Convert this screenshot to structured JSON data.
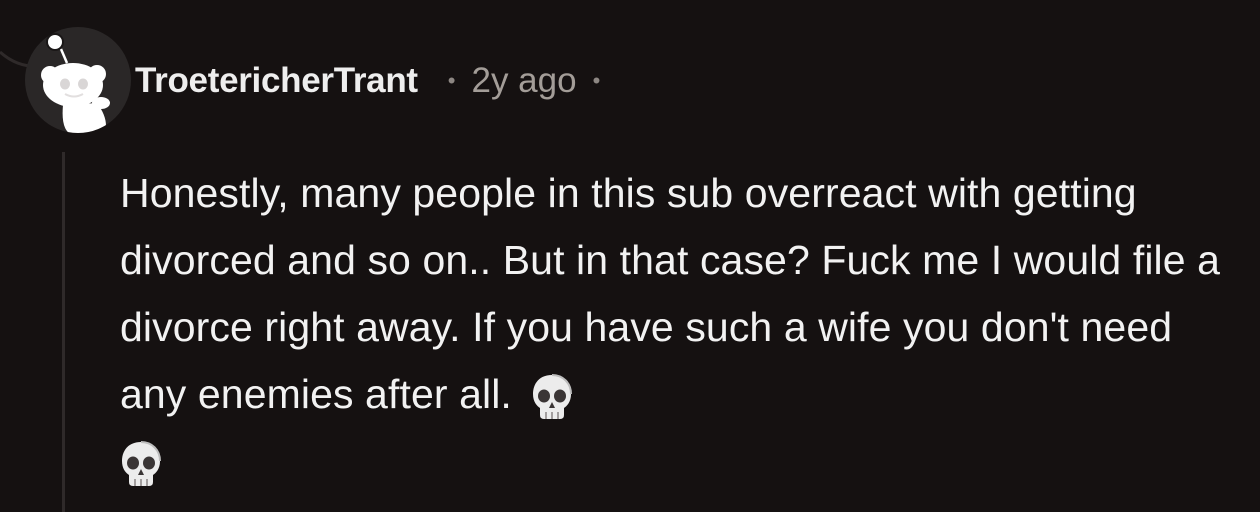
{
  "comment": {
    "author": "TroetericherTrant",
    "separator": "•",
    "timestamp": "2y ago",
    "body": "Honestly, many people in this sub overreact with getting divorced and so on.. But in that case? Fuck me I would file a divorce right away. If you have such a wife you don't need any enemies after all.",
    "emojis": [
      "skull-icon",
      "skull-icon"
    ]
  },
  "colors": {
    "background": "#151111",
    "username": "#eeeeee",
    "meta": "#a39d98",
    "body": "#f2f2f2",
    "thread_line": "#2f2a2a"
  }
}
